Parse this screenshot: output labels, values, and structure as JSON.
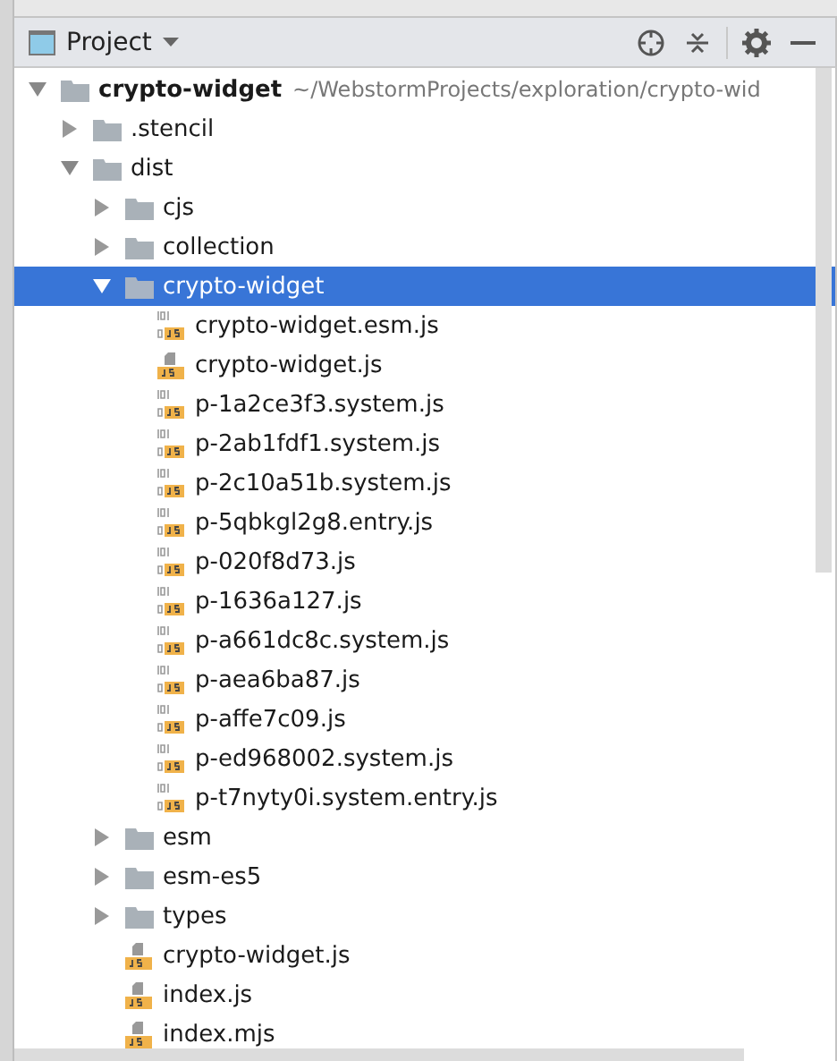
{
  "panel": {
    "title": "Project"
  },
  "tree": [
    {
      "kind": "folder",
      "name": "crypto-widget",
      "path": "~/WebstormProjects/exploration/crypto-wid",
      "expanded": true,
      "selected": false,
      "children": [
        {
          "kind": "folder",
          "name": ".stencil",
          "expanded": false,
          "selected": false
        },
        {
          "kind": "folder",
          "name": "dist",
          "expanded": true,
          "selected": false,
          "children": [
            {
              "kind": "folder",
              "name": "cjs",
              "expanded": false,
              "selected": false
            },
            {
              "kind": "folder",
              "name": "collection",
              "expanded": false,
              "selected": false
            },
            {
              "kind": "folder",
              "name": "crypto-widget",
              "expanded": true,
              "selected": true,
              "children": [
                {
                  "kind": "compiled",
                  "name": "crypto-widget.esm.js",
                  "selected": false
                },
                {
                  "kind": "script",
                  "name": "crypto-widget.js",
                  "selected": false
                },
                {
                  "kind": "compiled",
                  "name": "p-1a2ce3f3.system.js",
                  "selected": false
                },
                {
                  "kind": "compiled",
                  "name": "p-2ab1fdf1.system.js",
                  "selected": false
                },
                {
                  "kind": "compiled",
                  "name": "p-2c10a51b.system.js",
                  "selected": false
                },
                {
                  "kind": "compiled",
                  "name": "p-5qbkgl2g8.entry.js",
                  "selected": false
                },
                {
                  "kind": "compiled",
                  "name": "p-020f8d73.js",
                  "selected": false
                },
                {
                  "kind": "compiled",
                  "name": "p-1636a127.js",
                  "selected": false
                },
                {
                  "kind": "compiled",
                  "name": "p-a661dc8c.system.js",
                  "selected": false
                },
                {
                  "kind": "compiled",
                  "name": "p-aea6ba87.js",
                  "selected": false
                },
                {
                  "kind": "compiled",
                  "name": "p-affe7c09.js",
                  "selected": false
                },
                {
                  "kind": "compiled",
                  "name": "p-ed968002.system.js",
                  "selected": false
                },
                {
                  "kind": "compiled",
                  "name": "p-t7nyty0i.system.entry.js",
                  "selected": false
                }
              ]
            },
            {
              "kind": "folder",
              "name": "esm",
              "expanded": false,
              "selected": false
            },
            {
              "kind": "folder",
              "name": "esm-es5",
              "expanded": false,
              "selected": false
            },
            {
              "kind": "folder",
              "name": "types",
              "expanded": false,
              "selected": false
            },
            {
              "kind": "script",
              "name": "crypto-widget.js",
              "selected": false
            },
            {
              "kind": "script",
              "name": "index.js",
              "selected": false
            },
            {
              "kind": "script",
              "name": "index.mjs",
              "selected": false
            }
          ]
        }
      ]
    }
  ]
}
